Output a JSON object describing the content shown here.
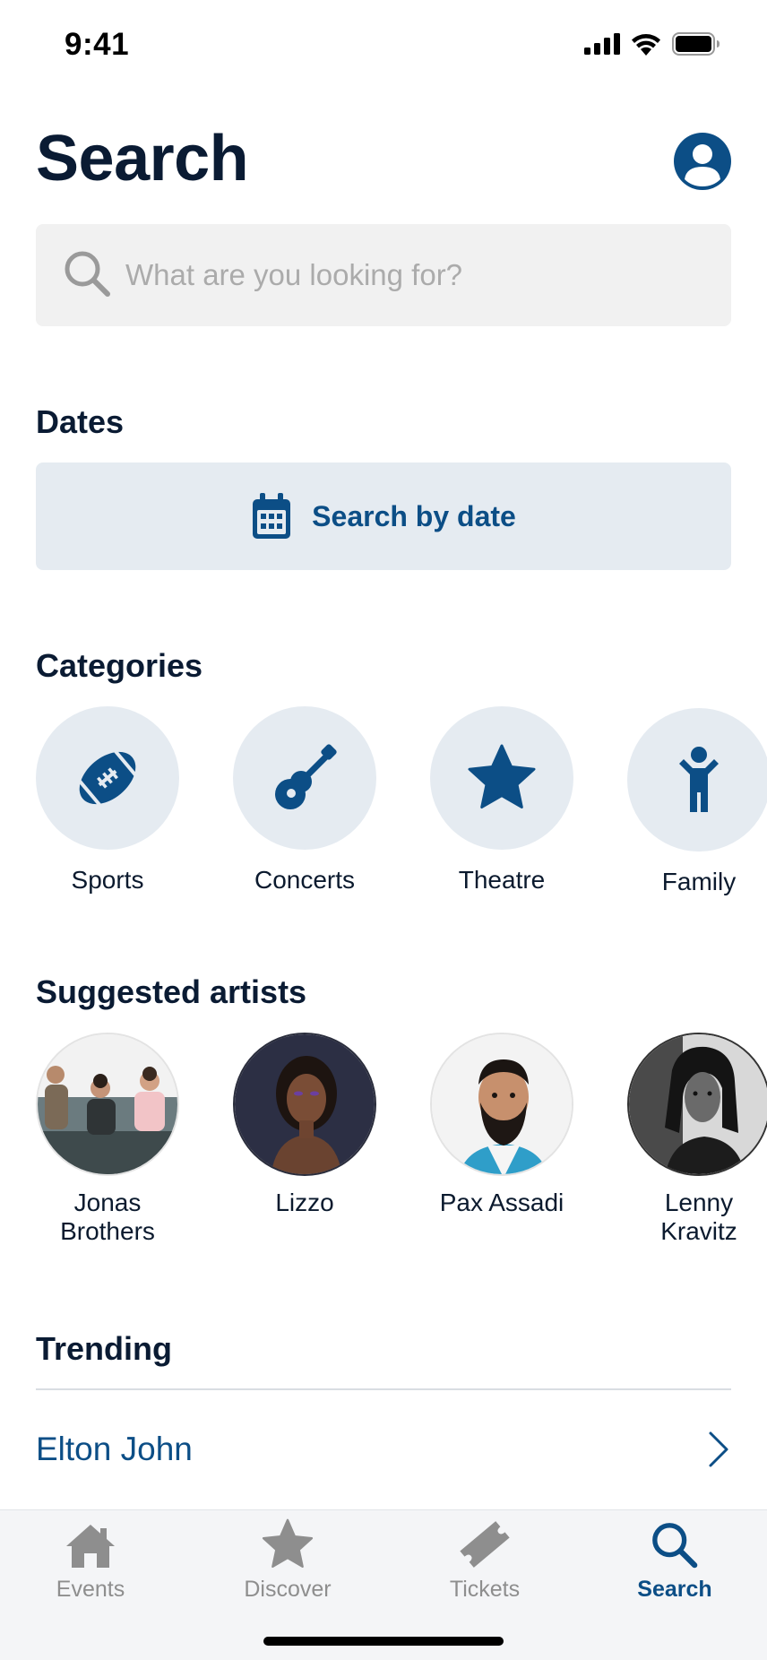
{
  "status_bar": {
    "time": "9:41",
    "icons": [
      "signal-icon",
      "wifi-icon",
      "battery-icon"
    ]
  },
  "header": {
    "title": "Search",
    "avatar_icon": "user-icon"
  },
  "search": {
    "placeholder": "What are you looking for?",
    "value": "",
    "icon": "search-icon"
  },
  "dates": {
    "title": "Dates",
    "button_label": "Search by date",
    "icon": "calendar-icon"
  },
  "categories": {
    "title": "Categories",
    "items": [
      {
        "label": "Sports",
        "icon": "football-icon"
      },
      {
        "label": "Concerts",
        "icon": "guitar-icon"
      },
      {
        "label": "Theatre",
        "icon": "star-icon"
      },
      {
        "label": "Family",
        "icon": "child-icon"
      }
    ]
  },
  "artists": {
    "title": "Suggested artists",
    "items": [
      {
        "line1": "Jonas",
        "line2": "Brothers"
      },
      {
        "line1": "Lizzo",
        "line2": ""
      },
      {
        "line1": "Pax Assadi",
        "line2": ""
      },
      {
        "line1": "Lenny",
        "line2": "Kravitz"
      }
    ]
  },
  "trending": {
    "title": "Trending",
    "items": [
      {
        "label": "Elton John",
        "icon": "chevron-right-icon"
      }
    ]
  },
  "tab_bar": {
    "tabs": [
      {
        "label": "Events",
        "icon": "home-icon",
        "active": false
      },
      {
        "label": "Discover",
        "icon": "star-icon",
        "active": false
      },
      {
        "label": "Tickets",
        "icon": "ticket-icon",
        "active": false
      },
      {
        "label": "Search",
        "icon": "search-icon",
        "active": true
      }
    ]
  },
  "colors": {
    "brand": "#0c4e86",
    "heading": "#0a1b33",
    "chip_background": "#e5ebf1",
    "search_background": "#f1f1f1",
    "inactive_tab": "#8e8e8e"
  }
}
